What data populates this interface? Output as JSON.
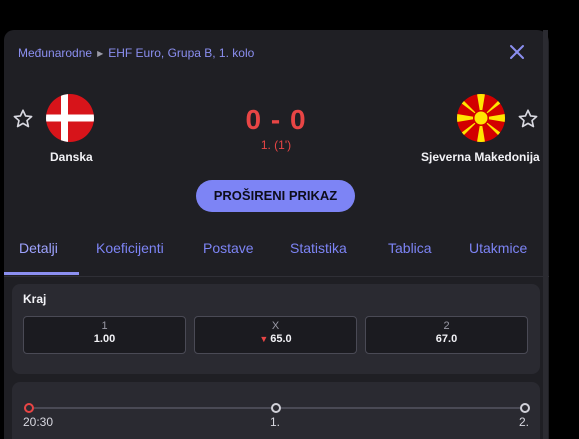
{
  "breadcrumb": {
    "category": "Međunarodne",
    "competition": "EHF Euro, Grupa B, 1. kolo"
  },
  "icons": {
    "close": "close-icon",
    "favorite": "star-outline-icon",
    "chevron": "triangle-right-icon"
  },
  "match": {
    "home": {
      "name": "Danska",
      "flag": "denmark-flag"
    },
    "away": {
      "name": "Sjeverna Makedonija",
      "flag": "north-macedonia-flag"
    },
    "score": "0 - 0",
    "period": "1. (1')"
  },
  "expand_button": "PROŠIRENI PRIKAZ",
  "tabs": [
    "Detalji",
    "Koeficijenti",
    "Postave",
    "Statistika",
    "Tablica",
    "Utakmice"
  ],
  "active_tab": "Detalji",
  "odds_card": {
    "title": "Kraj",
    "odds": [
      {
        "label": "1",
        "value": "1.00",
        "trend": "none"
      },
      {
        "label": "X",
        "value": "65.0",
        "trend": "down"
      },
      {
        "label": "2",
        "value": "67.0",
        "trend": "none"
      }
    ]
  },
  "timeline": {
    "points": [
      {
        "label": "20:30",
        "state": "live"
      },
      {
        "label": "1.",
        "state": "upcoming"
      },
      {
        "label": "2.",
        "state": "upcoming"
      }
    ]
  },
  "colors": {
    "accent": "#7d84f5",
    "score_live": "#e84545",
    "panel_bg": "#1f1f24",
    "card_bg": "#2a2a31"
  }
}
